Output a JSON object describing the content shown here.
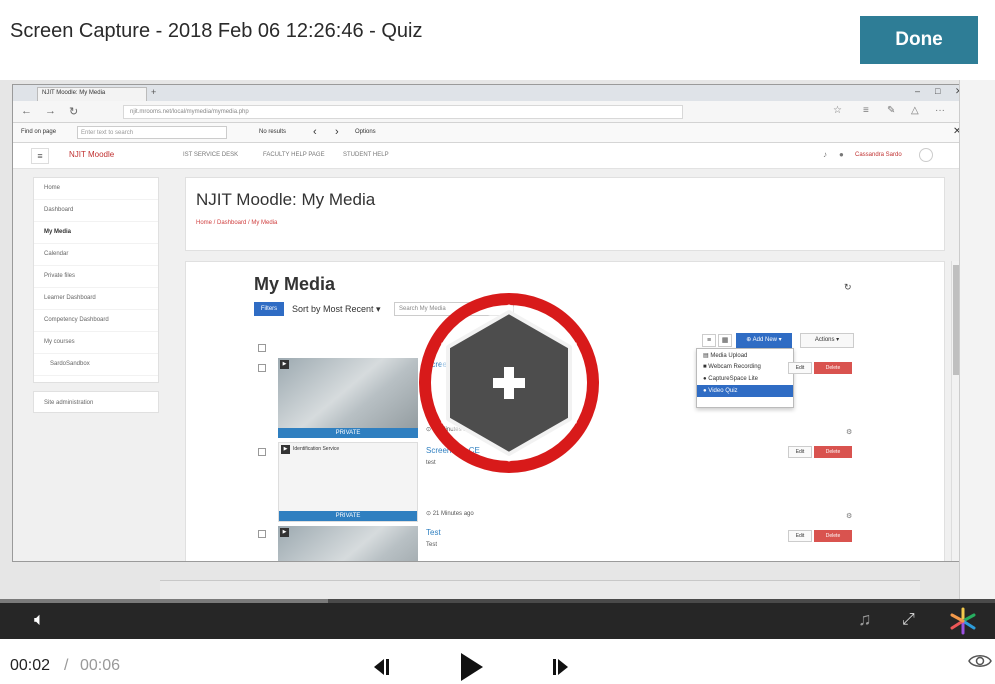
{
  "header": {
    "title": "Screen Capture - 2018 Feb 06 12:26:46 - Quiz",
    "done_label": "Done"
  },
  "browser": {
    "tab_title": "NJIT Moodle: My Media",
    "url": "njit.mrooms.net/local/mymedia/mymedia.php",
    "find_label": "Find on page",
    "find_placeholder": "Enter text to search",
    "find_result": "No results",
    "find_options": "Options"
  },
  "moodle": {
    "brand": "NJIT Moodle",
    "nav": [
      "IST SERVICE DESK",
      "FACULTY HELP PAGE",
      "STUDENT HELP"
    ],
    "user_name": "Cassandra Sardo",
    "sidebar": [
      "Home",
      "Dashboard",
      "My Media",
      "Calendar",
      "Private files",
      "Learner Dashboard",
      "Competency Dashboard",
      "My courses",
      "SardoSandbox"
    ],
    "site_admin": "Site administration",
    "page_title": "NJIT Moodle: My Media",
    "breadcrumb": "Home / Dashboard / My Media"
  },
  "media": {
    "title": "My Media",
    "filters_label": "Filters",
    "sort_label": "Sort by Most Recent",
    "search_placeholder": "Search My Media",
    "add_new_label": "Add New",
    "actions_label": "Actions",
    "add_new_menu": [
      "Media Upload",
      "Webcam Recording",
      "CaptureSpace Lite",
      "Video Quiz"
    ],
    "selected_menu_item": "Video Quiz",
    "entries": [
      {
        "title": "Screenshot_Quiz_Entry",
        "meta": "11 Minutes ago",
        "thumb_label": "PRIVATE"
      },
      {
        "title": "Screenshot CE",
        "desc": "test",
        "meta": "21 Minutes ago",
        "thumb_label": "PRIVATE",
        "doc_title": "Identification Service"
      },
      {
        "title": "Test",
        "desc": "Test"
      }
    ],
    "edit_label": "Edit",
    "delete_label": "Delete"
  },
  "player": {
    "time_current": "00:02",
    "time_separator": "/",
    "time_total": "00:06",
    "progress": 0.33
  },
  "colors": {
    "done_button": "#2e7d96",
    "quiz_ring": "#d81a1a",
    "quiz_hex": "#4d4d4d",
    "moodle_blue": "#2f6cc4",
    "delete_red": "#d9534f"
  }
}
